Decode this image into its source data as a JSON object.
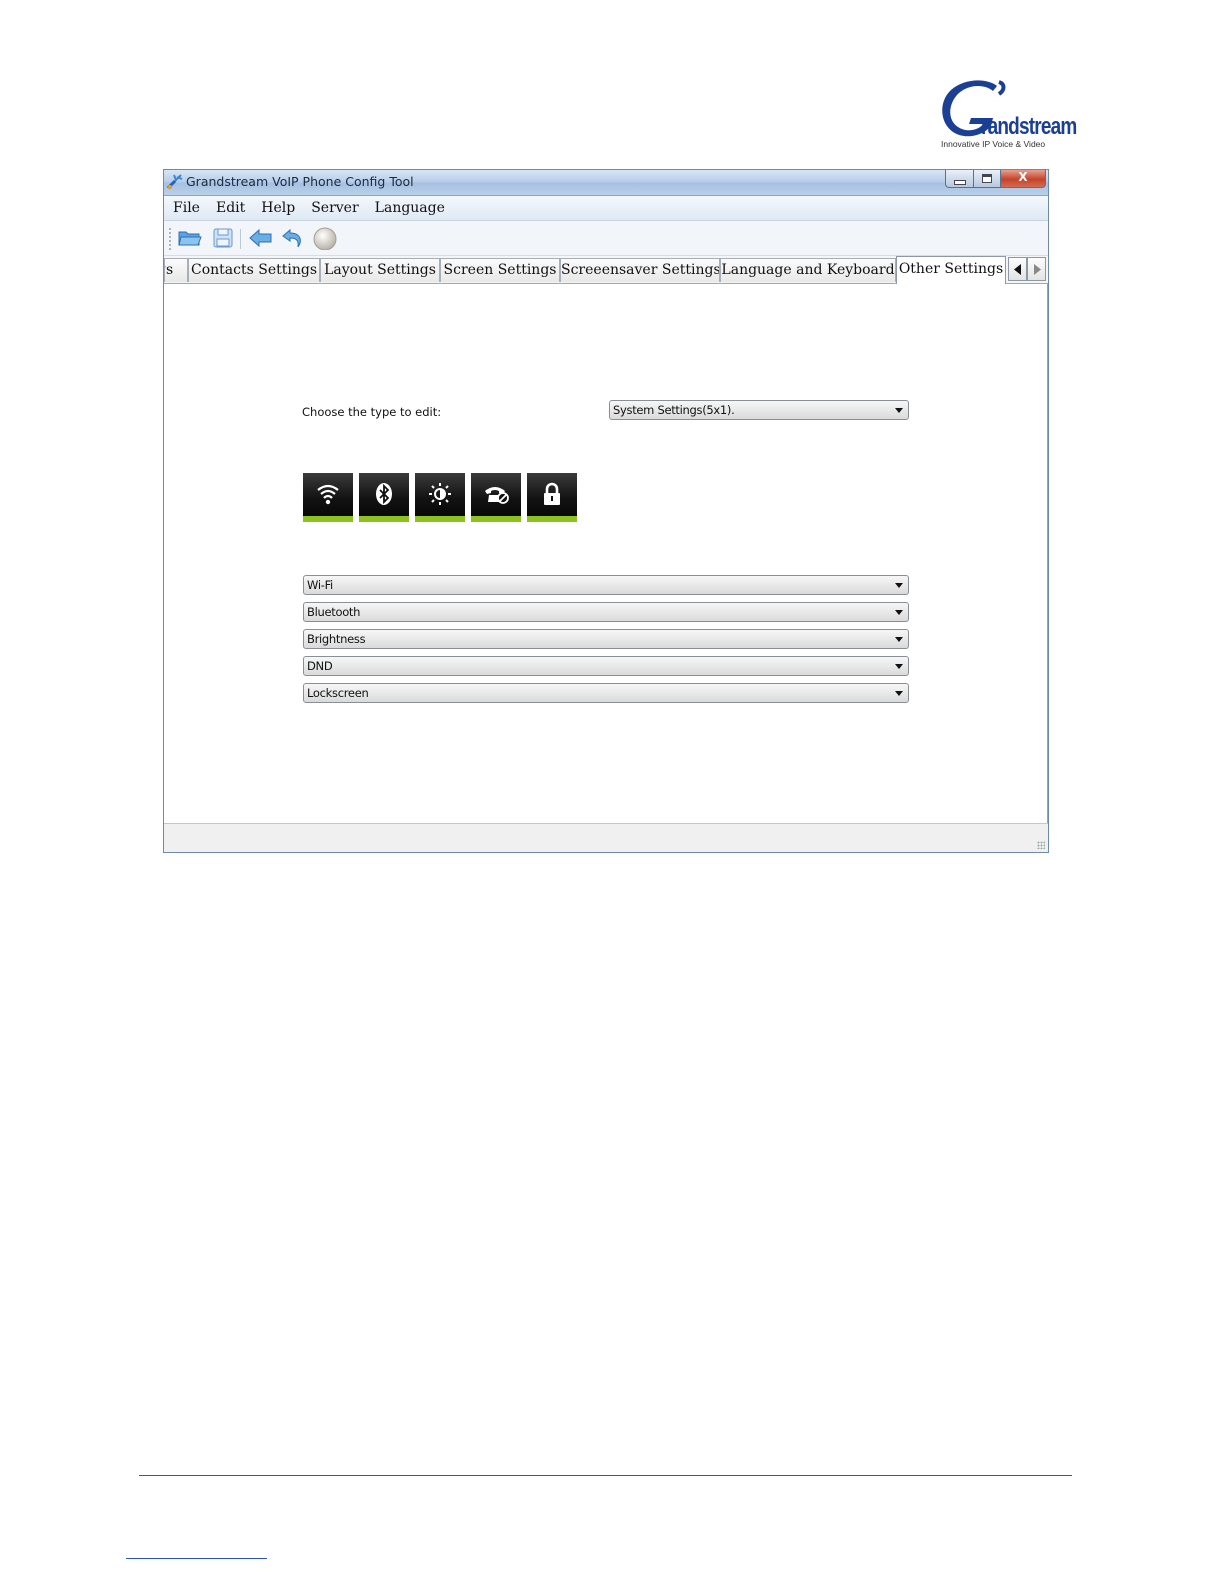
{
  "logo": {
    "wordmark": "randstream",
    "tagline": "Innovative IP Voice & Video"
  },
  "window": {
    "title": "Grandstream VoIP Phone Config Tool",
    "close_label": "X"
  },
  "menu": [
    "File",
    "Edit",
    "Help",
    "Server",
    "Language"
  ],
  "toolbar": {
    "icons": [
      "open-folder-icon",
      "save-icon",
      "back-arrow-icon",
      "undo-icon",
      "sphere-icon"
    ]
  },
  "tabs": [
    {
      "label": "gs",
      "active": false
    },
    {
      "label": "Contacts Settings",
      "active": false
    },
    {
      "label": "Layout Settings",
      "active": false
    },
    {
      "label": "Screen Settings",
      "active": false
    },
    {
      "label": "Screeensaver Settings",
      "active": false
    },
    {
      "label": "Language and Keyboard",
      "active": false
    },
    {
      "label": "Other Settings",
      "active": true
    }
  ],
  "editor": {
    "choose_label": "Choose the type to edit:",
    "type_selected": "System Settings(5x1).",
    "preview_icons": [
      "wifi-icon",
      "bluetooth-icon",
      "brightness-icon",
      "dnd-phone-icon",
      "lock-icon"
    ],
    "preview_accent": "#8bc21f",
    "slots": [
      "Wi-Fi",
      "Bluetooth",
      "Brightness",
      "DND",
      "Lockscreen"
    ]
  },
  "colors": {
    "logo_blue": "#1b3f94",
    "footer_link": "#2b4fc8"
  }
}
